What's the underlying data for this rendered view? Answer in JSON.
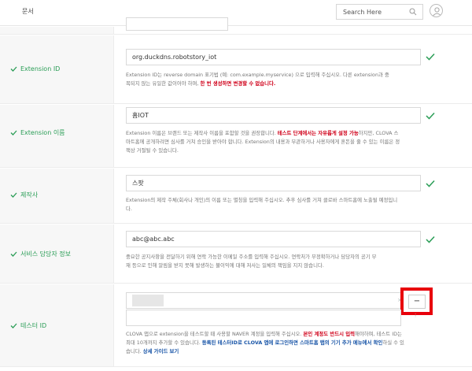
{
  "header": {
    "title": "문서",
    "search_placeholder": "Search Here"
  },
  "rows": {
    "top_field_value": "",
    "extension_id": {
      "label": "Extension ID",
      "value": "org.duckdns.robotstory_iot",
      "desc_a": "Extension ID는 reverse domain 표기법 (예: com.example.myservice) 으로 입력해 주십시오. 다른 extension과 중",
      "desc_b": "복되지 않는 유일한 값이어야 하며, ",
      "desc_red": "한 번 생성하면 변경할 수 없습니다."
    },
    "extension_name": {
      "label": "Extension 이름",
      "value": "홈IOT",
      "desc_a": "Extension 이름은 브랜드 또는 제작사 이름을 포함할 것을 권장합니다. ",
      "desc_red": "테스트 단계에서는 자유롭게 설정 가능",
      "desc_b": "하지만, CLOVA 스",
      "desc_c": "마트홈에 공개하려면 심사를 거쳐 승인을 받아야 합니다. Extension의 내용과 무관하거나 사용자에게 혼돈을 줄 수 있는 이름은 정",
      "desc_d": "책상 거절될 수 있습니다."
    },
    "maker": {
      "label": "제작사",
      "value": "스팟",
      "desc_a": "Extension의 제작 주체(회사나 개인)의 이름 또는 별칭을 입력해 주십시오. 추후 심사를 거쳐 클로바 스마트홈에 노출될 예정입니",
      "desc_b": "다."
    },
    "service_contact": {
      "label": "서비스 담당자 정보",
      "value": "abc@abc.abc",
      "desc_a": "중요한 공지사항을 전달하기 위해 연락 가능한 이메일 주소를 입력해 주십시오. 연락처가 부정확하거나 담당자의 공기 부",
      "desc_b": "재 등으로 인해 알림을 받지 못해 발생하는 불이익에 대해 저사는 일체의 책임을 지지 않습니다."
    },
    "tester_id": {
      "label": "테스터 ID",
      "minus_label": "−",
      "desc_a": "CLOVA 앱으로 extension을 테스트할 때 사용할 NAVER 계정을 입력해 주십시오. ",
      "desc_red": "본인 계정도 반드시 입력",
      "desc_b": "해야하며, 테스트 ID는",
      "desc_c": "최대 10개까지 추가할 수 있습니다. ",
      "desc_blue": "등록된 테스터ID로 CLOVA 앱에 로그인하면 스마트홈 탭의 기기 추가 메뉴에서 확인",
      "desc_d": "하실 수 있",
      "desc_e": "습니다. ",
      "desc_link": "상세 가이드 보기"
    }
  },
  "colors": {
    "accent_green": "#2a9d56",
    "highlight_red": "#e8000b",
    "warning_red": "#d0021b",
    "link_blue": "#1a56a8"
  }
}
